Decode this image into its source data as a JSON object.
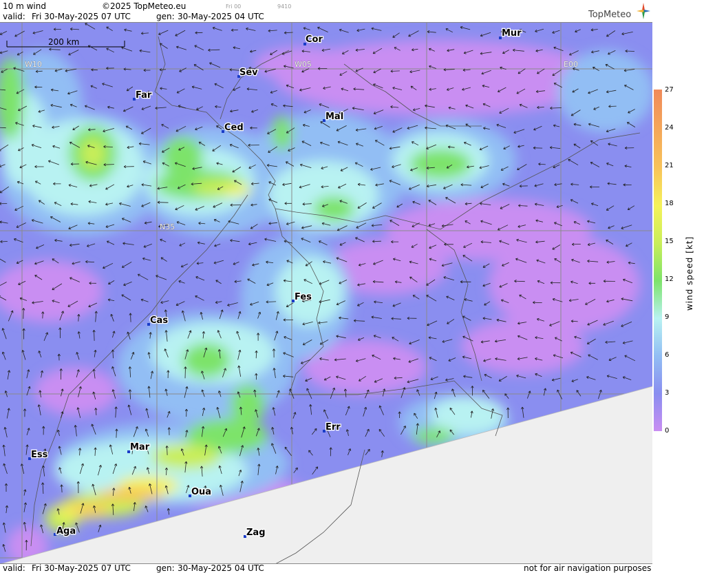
{
  "header": {
    "product": "10 m wind",
    "copyright": "©2025 TopMeteo.eu",
    "small_a": "Fri 00",
    "small_b": "9410",
    "valid_label": "valid:",
    "valid_value": "Fri  30-May-2025  07 UTC",
    "gen_label": "gen:",
    "gen_value": "30-May-2025 04 UTC"
  },
  "logo": {
    "text": "TopMeteo",
    "colors": [
      "#e24a2a",
      "#2b6fb8",
      "#f2b233",
      "#2a9a4a"
    ]
  },
  "scale_bar": {
    "label": "200 km"
  },
  "grid_labels": [
    "W10",
    "W05",
    "E00",
    "N35"
  ],
  "cities": [
    {
      "code": "Cor"
    },
    {
      "code": "Mur"
    },
    {
      "code": "Sev"
    },
    {
      "code": "Far"
    },
    {
      "code": "Ced"
    },
    {
      "code": "Mal"
    },
    {
      "code": "Fes"
    },
    {
      "code": "Cas"
    },
    {
      "code": "Err"
    },
    {
      "code": "Mar"
    },
    {
      "code": "Ess"
    },
    {
      "code": "Oua"
    },
    {
      "code": "Aga"
    },
    {
      "code": "Zag"
    }
  ],
  "legend": {
    "title": "wind speed [kt]",
    "ticks": [
      "27",
      "24",
      "21",
      "18",
      "15",
      "12",
      "9",
      "6",
      "3",
      "0"
    ],
    "colors": {
      "0-3": "#c98ef2",
      "3-6": "#8a8ef0",
      "6-9": "#92bef4",
      "9-12": "#b8f2f2",
      "12-15": "#7de36a",
      "15-18": "#c9ee59",
      "18-21": "#f5f25a",
      "21-24": "#f8c35a",
      "24-27": "#f08a5a"
    },
    "no_data_color": "#efefef"
  },
  "footer": {
    "valid_label": "valid:",
    "valid_value": "Fri  30-May-2025  07 UTC",
    "gen_label": "gen:",
    "gen_value": "30-May-2025 04 UTC",
    "disclaimer": "not for air navigation purposes"
  }
}
